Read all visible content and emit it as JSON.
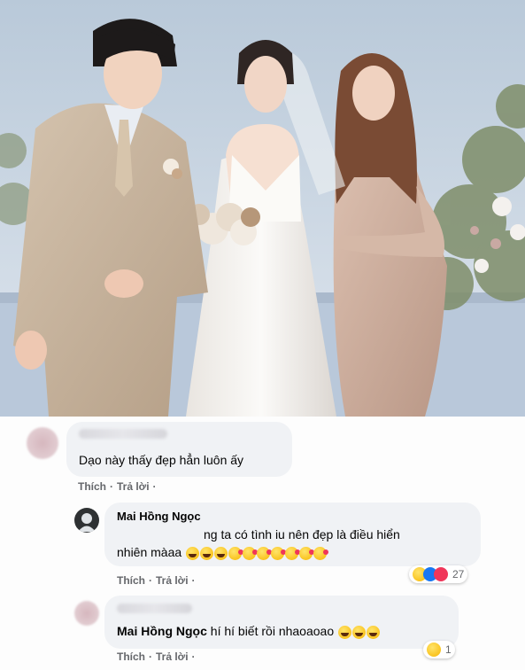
{
  "comments": [
    {
      "text": "Dạo này thấy đẹp hẳn luôn ấy",
      "actions": {
        "like": "Thích",
        "sep": "·",
        "reply": "Trả lời",
        "sep2": "·"
      }
    },
    {
      "author": "Mai Hồng Ngọc",
      "text_line1": "ng ta có tình iu nên đẹp là điều hiển",
      "text_line2": "nhiên màaa",
      "reaction_count": "27",
      "actions": {
        "like": "Thích",
        "sep": "·",
        "reply": "Trả lời",
        "sep2": "·"
      }
    },
    {
      "tag": "Mai Hồng Ngọc",
      "text": "hí hí biết rồi nhaoaoao",
      "reaction_count": "1",
      "actions": {
        "like": "Thích",
        "sep": "·",
        "reply": "Trả lời",
        "sep2": "·"
      }
    }
  ],
  "icons": {
    "reply_avatar": "dark-avatar",
    "reactions": [
      "haha-icon",
      "like-icon",
      "love-icon"
    ]
  },
  "colors": {
    "bubble": "#f0f2f5",
    "action": "#65676b",
    "like": "#1877f2",
    "love": "#f0365a"
  }
}
